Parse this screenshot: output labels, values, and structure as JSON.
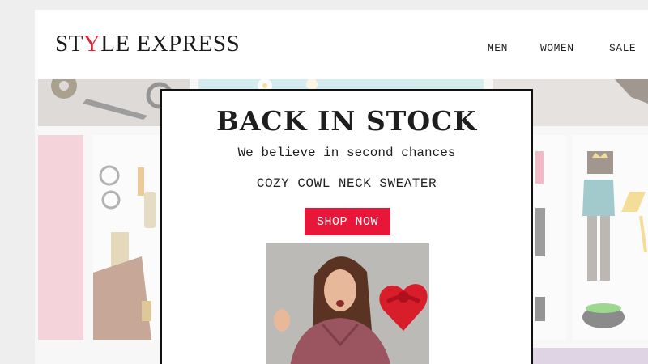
{
  "header": {
    "logo_pre": "ST",
    "logo_accent": "Y",
    "logo_post": "LE EXPRESS",
    "nav": {
      "men": "MEN",
      "women": "WOMEN",
      "sale": "SALE"
    }
  },
  "popup": {
    "title": "BACK IN STOCK",
    "subtitle": "We believe in second chances",
    "product": "COZY COWL NECK SWEATER",
    "cta": "SHOP NOW"
  },
  "colors": {
    "accent": "#e0243a",
    "button": "#e8173a",
    "text": "#1e1e1e"
  },
  "icons": [
    "scissors-image",
    "comb-image",
    "sunglasses-image",
    "wizard-illustration",
    "heart-box-image"
  ]
}
